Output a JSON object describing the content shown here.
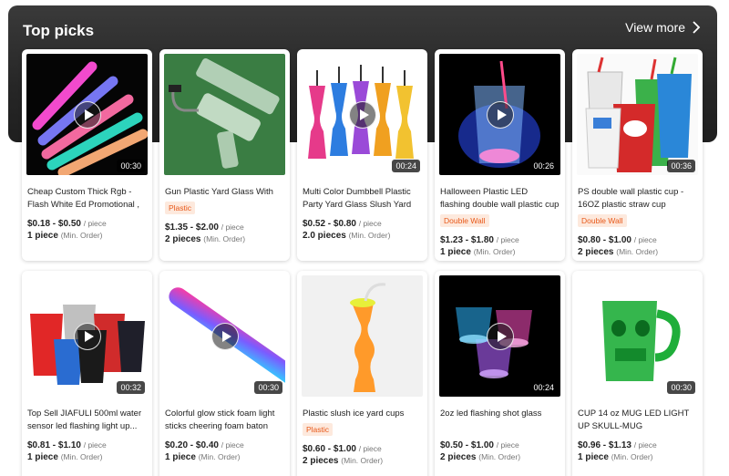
{
  "header": {
    "title": "Top picks",
    "view_more": "View more"
  },
  "colors": {
    "banner": "#262626",
    "tag_text": "#e8591a",
    "tag_bg": "#fde9dd"
  },
  "products": [
    {
      "title": "Cheap Custom Thick Rgb - Flash White Ed Promotional , Light U...",
      "tag": "",
      "price": "$0.18 - $0.50",
      "unit": "/ piece",
      "moq": "1 piece",
      "moq_label": "(Min. Order)",
      "duration": "00:30",
      "video": true,
      "image": "rgb-glow-sticks"
    },
    {
      "title": "Gun Plastic Yard Glass With Straw",
      "tag": "Plastic",
      "price": "$1.35 - $2.00",
      "unit": "/ piece",
      "moq": "2 pieces",
      "moq_label": "(Min. Order)",
      "duration": "",
      "video": false,
      "image": "gun-yard-glass"
    },
    {
      "title": "Multi Color Dumbbell Plastic Party Yard Glass Slush Yard Cups",
      "tag": "",
      "price": "$0.52 - $0.80",
      "unit": "/ piece",
      "moq": "2.0 pieces",
      "moq_label": "(Min. Order)",
      "duration": "00:24",
      "video": true,
      "image": "dumbbell-yard-cups"
    },
    {
      "title": "Halloween Plastic LED flashing double wall plastic cup with...",
      "tag": "Double Wall",
      "price": "$1.23 - $1.80",
      "unit": "/ piece",
      "moq": "1 piece",
      "moq_label": "(Min. Order)",
      "duration": "00:26",
      "video": true,
      "image": "led-tumbler"
    },
    {
      "title": "PS double wall plastic cup - 16OZ plastic straw cup",
      "tag": "Double Wall",
      "price": "$0.80 - $1.00",
      "unit": "/ piece",
      "moq": "2 pieces",
      "moq_label": "(Min. Order)",
      "duration": "00:36",
      "video": false,
      "image": "double-wall-cups"
    },
    {
      "title": "Top Sell JIAFULI 500ml water sensor led flashing light up...",
      "tag": "",
      "price": "$0.81 - $1.10",
      "unit": "/ piece",
      "moq": "1 piece",
      "moq_label": "(Min. Order)",
      "duration": "00:32",
      "video": true,
      "image": "led-beer-cups"
    },
    {
      "title": "Colorful glow stick foam light sticks cheering foam baton",
      "tag": "",
      "price": "$0.20 - $0.40",
      "unit": "/ piece",
      "moq": "1 piece",
      "moq_label": "(Min. Order)",
      "duration": "00:30",
      "video": true,
      "image": "foam-baton"
    },
    {
      "title": "Plastic slush ice yard cups",
      "tag": "Plastic",
      "price": "$0.60 - $1.00",
      "unit": "/ piece",
      "moq": "2 pieces",
      "moq_label": "(Min. Order)",
      "duration": "",
      "video": false,
      "image": "slush-yard-cup"
    },
    {
      "title": "2oz led flashing shot glass",
      "tag": "",
      "price": "$0.50 - $1.00",
      "unit": "/ piece",
      "moq": "2 pieces",
      "moq_label": "(Min. Order)",
      "duration": "00:24",
      "video": true,
      "image": "led-shot-glasses"
    },
    {
      "title": "CUP 14 oz MUG LED LIGHT UP SKULL-MUG",
      "tag": "",
      "price": "$0.96 - $1.13",
      "unit": "/ piece",
      "moq": "1 piece",
      "moq_label": "(Min. Order)",
      "duration": "00:30",
      "video": false,
      "image": "skull-mug"
    }
  ]
}
